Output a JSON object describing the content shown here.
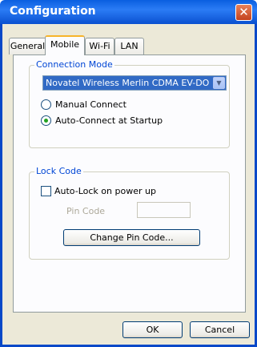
{
  "window": {
    "title": "Configuration",
    "close_glyph": "✕"
  },
  "tabs": [
    {
      "label": "General",
      "active": false
    },
    {
      "label": "Mobile",
      "active": true
    },
    {
      "label": "Wi-Fi",
      "active": false
    },
    {
      "label": "LAN",
      "active": false
    }
  ],
  "connection_mode": {
    "legend": "Connection Mode",
    "device_select": {
      "value": "Novatel Wireless Merlin CDMA EV-DO Modem",
      "arrow_glyph": "▼"
    },
    "options": [
      {
        "label": "Manual Connect",
        "selected": false
      },
      {
        "label": "Auto-Connect at Startup",
        "selected": true
      }
    ]
  },
  "lock_code": {
    "legend": "Lock Code",
    "auto_lock": {
      "label": "Auto-Lock on power up",
      "checked": false
    },
    "pin_label": "Pin Code",
    "pin_value": "",
    "change_button": "Change Pin Code..."
  },
  "buttons": {
    "ok": "OK",
    "cancel": "Cancel"
  },
  "colors": {
    "accent": "#0a5fe0",
    "legend_text": "#0046d5",
    "face": "#ece9d8",
    "selection": "#316ac5"
  }
}
